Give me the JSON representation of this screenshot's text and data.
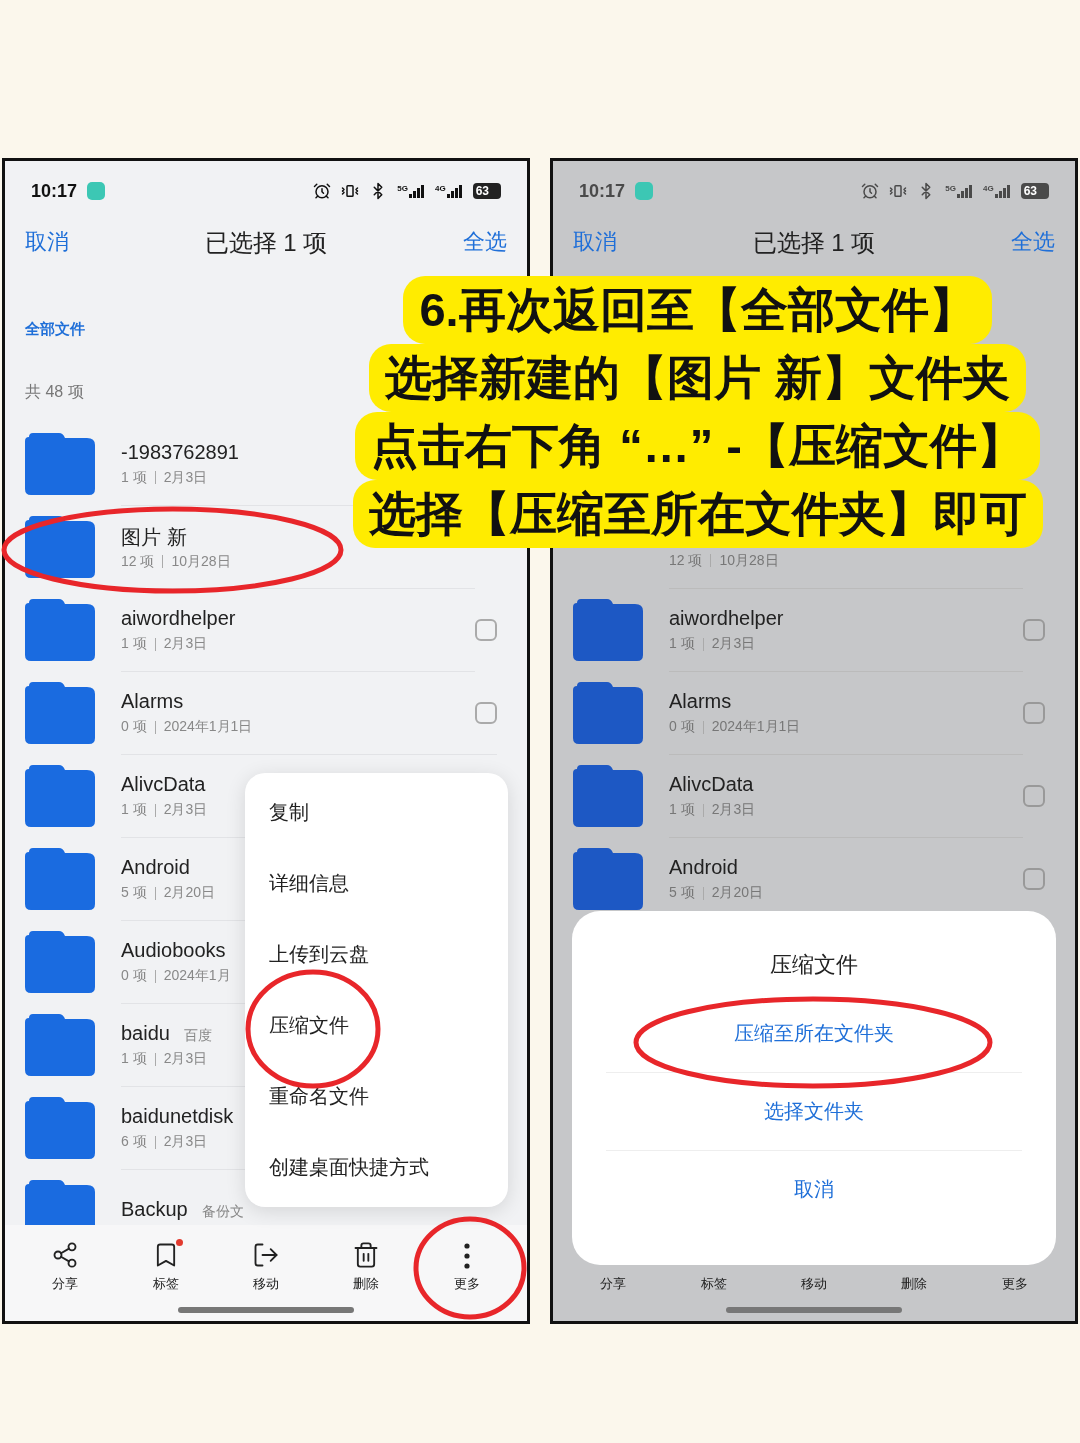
{
  "phones": [
    {
      "dimmed": false,
      "status_bar": {
        "time": "10:17",
        "network_labels": [
          "5G",
          "4G"
        ],
        "battery": "63"
      },
      "header": {
        "cancel": "取消",
        "title": "已选择 1 项",
        "select_all": "全选"
      },
      "breadcrumb": "全部文件",
      "count": "共 48 项",
      "rows": [
        {
          "name": "-1983762891",
          "meta": [
            "1 项",
            "2月3日"
          ]
        },
        {
          "name": "图片 新",
          "meta": [
            "12 项",
            "10月28日"
          ]
        },
        {
          "name": "aiwordhelper",
          "meta": [
            "1 项",
            "2月3日"
          ],
          "checked": false
        },
        {
          "name": "Alarms",
          "meta": [
            "0 项",
            "2024年1月1日"
          ],
          "checked": false
        },
        {
          "name": "AlivcData",
          "meta": [
            "1 项",
            "2月3日"
          ]
        },
        {
          "name": "Android",
          "meta": [
            "5 项",
            "2月20日"
          ]
        },
        {
          "name": "Audiobooks",
          "meta": [
            "0 项",
            "2024年1月"
          ]
        },
        {
          "name": "baidu",
          "tag": "百度",
          "meta": [
            "1 项",
            "2月3日"
          ]
        },
        {
          "name": "baidunetdisk",
          "meta": [
            "6 项",
            "2月3日"
          ]
        },
        {
          "name": "Backup",
          "tag": "备份文"
        }
      ],
      "menu": [
        "复制",
        "详细信息",
        "上传到云盘",
        "压缩文件",
        "重命名文件",
        "创建桌面快捷方式"
      ],
      "toolbar": [
        {
          "label": "分享",
          "kind": "share"
        },
        {
          "label": "标签",
          "kind": "tag"
        },
        {
          "label": "移动",
          "kind": "move"
        },
        {
          "label": "删除",
          "kind": "delete"
        },
        {
          "label": "更多",
          "kind": "more"
        }
      ]
    },
    {
      "dimmed": true,
      "status_bar": {
        "time": "10:17",
        "network_labels": [
          "5G",
          "4G"
        ],
        "battery": "63"
      },
      "header": {
        "cancel": "取消",
        "title": "已选择 1 项",
        "select_all": "全选"
      },
      "rows": [
        {
          "meta": [
            "12 项",
            "10月28日"
          ]
        },
        {
          "name": "aiwordhelper",
          "meta": [
            "1 项",
            "2月3日"
          ],
          "checked": false
        },
        {
          "name": "Alarms",
          "meta": [
            "0 项",
            "2024年1月1日"
          ],
          "checked": false
        },
        {
          "name": "AlivcData",
          "meta": [
            "1 项",
            "2月3日"
          ],
          "checked": false
        },
        {
          "name": "Android",
          "meta": [
            "5 项",
            "2月20日"
          ],
          "checked": false
        }
      ],
      "sheet": {
        "title": "压缩文件",
        "options": [
          "压缩至所在文件夹",
          "选择文件夹",
          "取消"
        ]
      },
      "toolbar": [
        {
          "label": "分享"
        },
        {
          "label": "标签"
        },
        {
          "label": "移动"
        },
        {
          "label": "删除"
        },
        {
          "label": "更多"
        }
      ]
    }
  ],
  "caption": {
    "lines": [
      "6.再次返回至【全部文件】",
      "选择新建的【图片 新】文件夹",
      "点击右下角 “…” -【压缩文件】",
      "选择【压缩至所在文件夹】即可"
    ]
  }
}
